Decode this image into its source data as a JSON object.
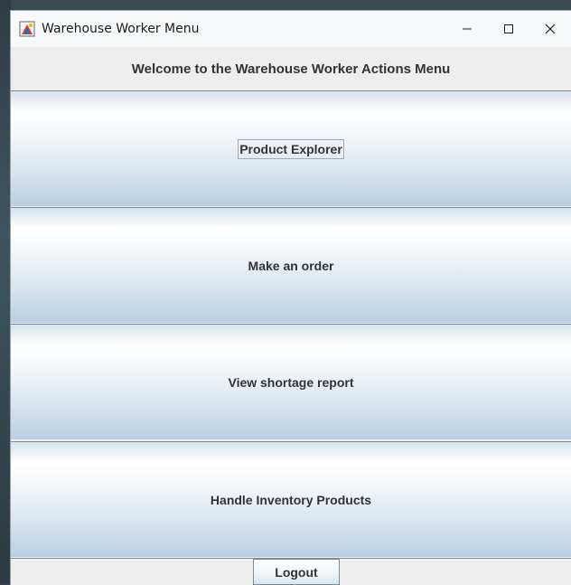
{
  "window": {
    "title": "Warehouse Worker Menu",
    "icon": "java-app-icon",
    "controls": {
      "minimize": "—",
      "maximize": "☐",
      "close": "✕"
    }
  },
  "header": {
    "label": "Welcome to the Warehouse Worker Actions Menu"
  },
  "menu": {
    "product_explorer": "Product Explorer",
    "make_order": "Make an order",
    "shortage_report": "View shortage report",
    "inventory_products": "Handle Inventory Products"
  },
  "footer": {
    "logout": "Logout"
  },
  "colors": {
    "button_gradient_top": "#ffffff",
    "button_gradient_bottom": "#b8cfe2",
    "panel_bg": "#eeeeee",
    "text": "#333333"
  }
}
